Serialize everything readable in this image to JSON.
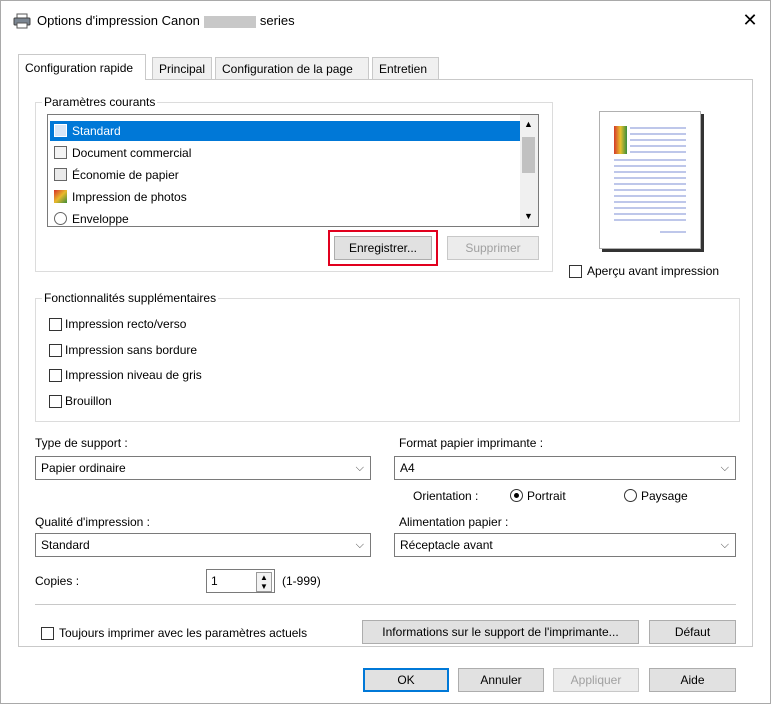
{
  "window": {
    "title_prefix": "Options d'impression Canon",
    "title_suffix": "series",
    "close_glyph": "✕"
  },
  "tabs": [
    {
      "label": "Configuration rapide",
      "active": true
    },
    {
      "label": "Principal",
      "active": false
    },
    {
      "label": "Configuration de la page",
      "active": false
    },
    {
      "label": "Entretien",
      "active": false
    }
  ],
  "current_settings": {
    "legend": "Paramètres courants",
    "items": [
      {
        "label": "Standard",
        "icon": "standard-icon",
        "selected": true
      },
      {
        "label": "Document commercial",
        "icon": "document-icon",
        "selected": false
      },
      {
        "label": "Économie de papier",
        "icon": "paper-saving-icon",
        "selected": false
      },
      {
        "label": "Impression de photos",
        "icon": "photo-icon",
        "selected": false
      },
      {
        "label": "Enveloppe",
        "icon": "envelope-icon",
        "selected": false
      }
    ],
    "save_label": "Enregistrer...",
    "delete_label": "Supprimer"
  },
  "preview": {
    "checkbox_label": "Aperçu avant impression",
    "checked": false
  },
  "additional": {
    "legend": "Fonctionnalités supplémentaires",
    "items": [
      {
        "label": "Impression recto/verso",
        "checked": false
      },
      {
        "label": "Impression sans bordure",
        "checked": false
      },
      {
        "label": "Impression niveau de gris",
        "checked": false
      },
      {
        "label": "Brouillon",
        "checked": false
      }
    ]
  },
  "media_type": {
    "label": "Type de support :",
    "value": "Papier ordinaire"
  },
  "printer_paper_size": {
    "label": "Format papier imprimante :",
    "value": "A4"
  },
  "orientation": {
    "label": "Orientation :",
    "portrait": "Portrait",
    "landscape": "Paysage",
    "selected": "Portrait"
  },
  "print_quality": {
    "label": "Qualité d'impression :",
    "value": "Standard"
  },
  "paper_source": {
    "label": "Alimentation papier :",
    "value": "Réceptacle avant"
  },
  "copies": {
    "label": "Copies :",
    "value": "1",
    "range": "(1-999)"
  },
  "always_print": {
    "label": "Toujours imprimer avec les paramètres actuels",
    "checked": false
  },
  "media_info_button": "Informations sur le support de l'imprimante...",
  "default_button": "Défaut",
  "footer": {
    "ok": "OK",
    "cancel": "Annuler",
    "apply": "Appliquer",
    "help": "Aide"
  },
  "colors": {
    "accent": "#0078d7",
    "highlight": "#e1001e"
  }
}
